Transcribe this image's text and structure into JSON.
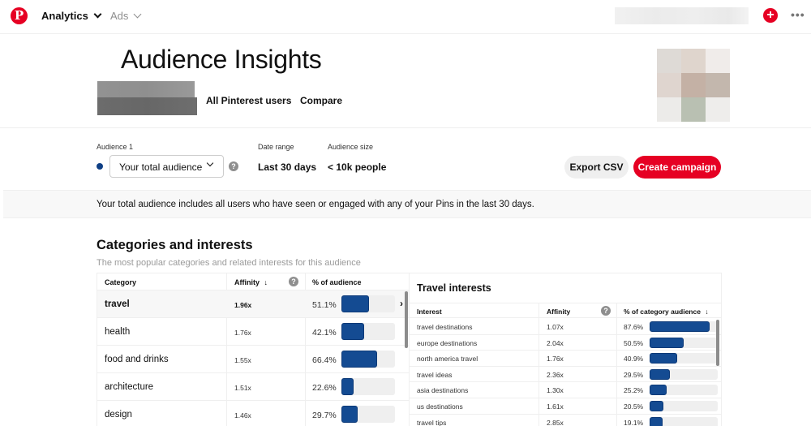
{
  "topnav": {
    "logo": "P",
    "analytics_label": "Analytics",
    "ads_label": "Ads",
    "plus_icon": "+",
    "more_icon": "•••"
  },
  "header": {
    "title": "Audience Insights",
    "tabs": [
      "All Pinterest users",
      "Compare"
    ]
  },
  "controls": {
    "audience_label": "Audience 1",
    "audience_value": "Your total audience",
    "audience_color": "#0e3f85",
    "help_icon": "?",
    "date_range_label": "Date range",
    "date_range_value": "Last 30 days",
    "audience_size_label": "Audience size",
    "audience_size_value": "< 10k people",
    "export_label": "Export CSV",
    "create_label": "Create campaign"
  },
  "info": {
    "text": "Your total audience includes all users who have seen or engaged with any of your Pins in the last 30 days."
  },
  "section": {
    "title": "Categories and interests",
    "subtitle": "The most popular categories and related interests for this audience"
  },
  "categories": {
    "headers": {
      "category": "Category",
      "affinity": "Affinity",
      "sort_icon": "↓",
      "percent": "% of audience"
    },
    "rows": [
      {
        "name": "travel",
        "affinity": "1.96x",
        "percent": "51.1%",
        "value": 51.1,
        "selected": true
      },
      {
        "name": "health",
        "affinity": "1.76x",
        "percent": "42.1%",
        "value": 42.1
      },
      {
        "name": "food and drinks",
        "affinity": "1.55x",
        "percent": "66.4%",
        "value": 66.4
      },
      {
        "name": "architecture",
        "affinity": "1.51x",
        "percent": "22.6%",
        "value": 22.6
      },
      {
        "name": "design",
        "affinity": "1.46x",
        "percent": "29.7%",
        "value": 29.7
      }
    ],
    "expand_icon": "›"
  },
  "interests": {
    "title": "Travel interests",
    "headers": {
      "interest": "Interest",
      "affinity": "Affinity",
      "percent": "% of category audience",
      "sort_icon": "↓"
    },
    "rows": [
      {
        "name": "travel destinations",
        "affinity": "1.07x",
        "percent": "87.6%",
        "value": 87.6
      },
      {
        "name": "europe destinations",
        "affinity": "2.04x",
        "percent": "50.5%",
        "value": 50.5
      },
      {
        "name": "north america travel",
        "affinity": "1.76x",
        "percent": "40.9%",
        "value": 40.9
      },
      {
        "name": "travel ideas",
        "affinity": "2.36x",
        "percent": "29.5%",
        "value": 29.5
      },
      {
        "name": "asia destinations",
        "affinity": "1.30x",
        "percent": "25.2%",
        "value": 25.2
      },
      {
        "name": "us destinations",
        "affinity": "1.61x",
        "percent": "20.5%",
        "value": 20.5
      },
      {
        "name": "travel tips",
        "affinity": "2.85x",
        "percent": "19.1%",
        "value": 19.1
      }
    ]
  },
  "colors": {
    "brand_red": "#e60023",
    "bar_blue": "#144b92"
  }
}
